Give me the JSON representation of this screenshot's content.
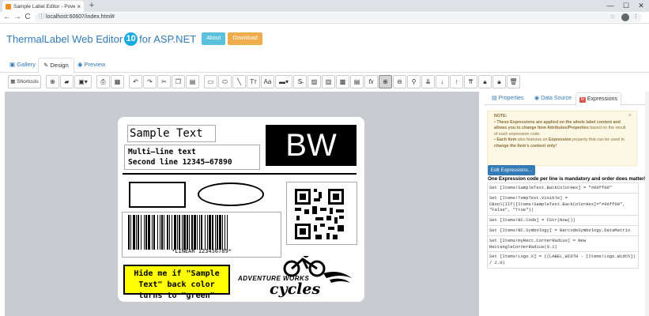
{
  "browser": {
    "tab_title": "Sample Label Editor - Powered b",
    "tab_close": "×",
    "new_tab": "+",
    "win_min": "—",
    "win_max": "☐",
    "win_close": "✕",
    "back": "←",
    "forward": "→",
    "reload": "C",
    "url": "localhost:60607/index.html#",
    "star": "☆",
    "menu": "⋮"
  },
  "header": {
    "title": "ThermalLabel Web Editor",
    "version": "10",
    "for_text": "for ASP.NET",
    "about_label": "About",
    "download_label": "Download"
  },
  "tabs": [
    {
      "label": "Gallery",
      "icon": "image-icon"
    },
    {
      "label": "Design",
      "icon": "pencil-icon"
    },
    {
      "label": "Preview",
      "icon": "eye-icon"
    }
  ],
  "toolbar": {
    "shortcuts_label": "Shortcuts"
  },
  "label": {
    "sample_text": "Sample Text",
    "multiline_1": "Multi–line text",
    "multiline_2": "Second line 12345–67890",
    "bw_text": "BW",
    "barcode_text": "*LINEAR 123456789*",
    "hide_text": "Hide me if \"Sample Text\" back color turns to \"green\"",
    "logo_line1": "ADVENTURE WORKS",
    "logo_line2": "cycles"
  },
  "sidebar": {
    "tab_properties": "Properties",
    "tab_datasource": "Data Source",
    "tab_expressions": "Expressions",
    "note_title": "NOTE:",
    "note_bullet1_bold": "These Expressions are applied on the whole label content and allows you to change Item Attributes/Properties",
    "note_bullet1_rest": " based on the result of each expression code.",
    "note_bullet2_bold": "Each Item",
    "note_bullet2_mid": " also features an ",
    "note_bullet2_bold2": "Expression",
    "note_bullet2_rest": " property that can be used to ",
    "note_bullet2_bold3": "change the Item's content only!",
    "close": "×",
    "edit_button": "Edit Expressions...",
    "mandatory_text": "One Expression code per line is mandatory and order does matter!",
    "expressions": [
      "Set [Items!SampleText.BackColorHex] = \"#00ff00\"",
      "Set [Items!TempText.Visible] = CBool(IIf([Items!SampleText.BackColorHex]=\"#00ff00\", \"False\", \"True\"))",
      "Set [Items!BC.Code] = CStr(Now())",
      "Set [Items!BC.Symbology] = BarcodeSymbology.DataMatrix",
      "Set [Items!myRect.CornerRadius] = New RectangleCornerRadius(0.1)",
      "Set [Items!Logo.X] = ((LABEL_WIDTH - [Items!Logo.Width]) / 2.0)"
    ]
  }
}
